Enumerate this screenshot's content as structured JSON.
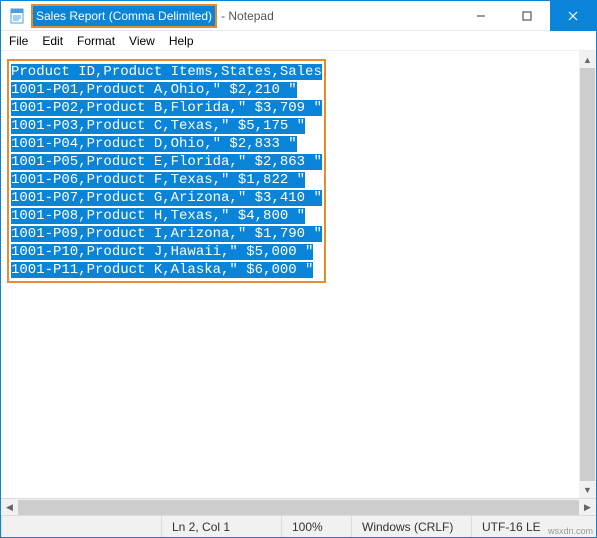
{
  "titlebar": {
    "highlighted_title": "Sales Report (Comma Delimited)",
    "suffix": " - Notepad",
    "icon": "notepad-icon"
  },
  "menubar": {
    "items": [
      "File",
      "Edit",
      "Format",
      "View",
      "Help"
    ]
  },
  "content": {
    "lines": [
      "Product ID,Product Items,States,Sales",
      "1001-P01,Product A,Ohio,\" $2,210 \"",
      "1001-P02,Product B,Florida,\" $3,709 \"",
      "1001-P03,Product C,Texas,\" $5,175 \"",
      "1001-P04,Product D,Ohio,\" $2,833 \"",
      "1001-P05,Product E,Florida,\" $2,863 \"",
      "1001-P06,Product F,Texas,\" $1,822 \"",
      "1001-P07,Product G,Arizona,\" $3,410 \"",
      "1001-P08,Product H,Texas,\" $4,800 \"",
      "1001-P09,Product I,Arizona,\" $1,790 \"",
      "1001-P10,Product J,Hawaii,\" $5,000 \"",
      "1001-P11,Product K,Alaska,\" $6,000 \""
    ]
  },
  "statusbar": {
    "position": "Ln 2, Col 1",
    "zoom": "100%",
    "eol": "Windows (CRLF)",
    "encoding": "UTF-16 LE"
  },
  "watermark": "wsxdn.com"
}
